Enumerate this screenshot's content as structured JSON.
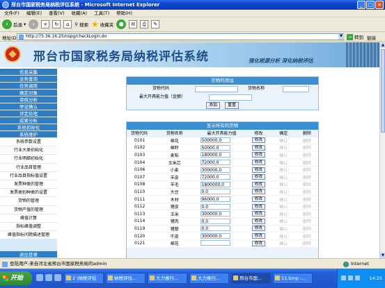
{
  "window": {
    "title": "邢台市国家税务局纳税评估系统 - Microsoft Internet Explorer"
  },
  "menu": [
    "文件(F)",
    "编辑(E)",
    "查看(V)",
    "收藏(A)",
    "工具(T)",
    "帮助(H)"
  ],
  "toolbar": {
    "back": "后退",
    "search": "搜索",
    "favorites": "收藏夹"
  },
  "address": {
    "label": "地址(D)",
    "url": "http://75.36.16.25/nspg/checkLogin.do",
    "go": "转到",
    "links": "链接"
  },
  "banner": {
    "title": "邢台市国家税务局纳税评估系统",
    "slogan": "强化税源分析  深化纳税评估"
  },
  "sidebar": {
    "sections": [
      "信息采集",
      "业务查询",
      "任务调用",
      "确定对象",
      "审核分析",
      "举证确认",
      "评定处理",
      "成果分析",
      "系统初始化",
      "系统维护"
    ],
    "items": [
      "系统参数设置",
      "行业大类初始化",
      "行业明细初始化",
      "行业品目管理",
      "行业品目指标值设置",
      "发票种类的管理",
      "发票类别种类的设置",
      "货物的管理",
      "货物产值的管理",
      "峰值计算",
      "指标峰值调整",
      "峰值指标问题描述管理"
    ],
    "exit": "退出登录"
  },
  "add_panel": {
    "title": "货物的添加",
    "code_label": "货物代码",
    "name_label": "货物名称",
    "cap_label": "最大开具能力值（金额）",
    "add_btn": "添加",
    "reset_btn": "重置"
  },
  "list_panel": {
    "title": "显示所有的货物",
    "headers": [
      "货物代码",
      "货物名称",
      "最大开具能力值",
      "修改",
      "确定",
      "删除"
    ],
    "edit_label": "修改",
    "confirm_label": "确认",
    "delete_label": "删除",
    "rows": [
      {
        "code": "0101",
        "name": "棉花",
        "value": "500000.0"
      },
      {
        "code": "0102",
        "name": "棉籽",
        "value": "50000.0"
      },
      {
        "code": "0103",
        "name": "麦稻",
        "value": "180000.0"
      },
      {
        "code": "0104",
        "name": "玉米芯",
        "value": "72000.0"
      },
      {
        "code": "0106",
        "name": "小麦",
        "value": "300000.0"
      },
      {
        "code": "0107",
        "name": "羊皮",
        "value": "72000.0"
      },
      {
        "code": "0108",
        "name": "羊毛",
        "value": "1800000.0"
      },
      {
        "code": "0110",
        "name": "大豆",
        "value": "0.0"
      },
      {
        "code": "0111",
        "name": "木材",
        "value": "96000.0"
      },
      {
        "code": "0112",
        "name": "猪皮",
        "value": "0.0"
      },
      {
        "code": "0113",
        "name": "玉米",
        "value": "300000.0"
      },
      {
        "code": "0114",
        "name": "猪肉",
        "value": "0.0"
      },
      {
        "code": "0119",
        "name": "猪鬃",
        "value": "0.0"
      },
      {
        "code": "0120",
        "name": "牛皮",
        "value": "300000.0"
      },
      {
        "code": "0121",
        "name": "棉花",
        "value": ""
      }
    ]
  },
  "status": {
    "text": "登陆用户:来自河北省邢台市国家税务局的admin",
    "zone": "Internet"
  },
  "taskbar": {
    "start": "开始",
    "tasks": [
      "2 \\纳税评估",
      "纳税评估...",
      "大力推行...",
      "大力推行...",
      "邢台市国...",
      "11.bmp -..."
    ],
    "clock": "14:25"
  }
}
